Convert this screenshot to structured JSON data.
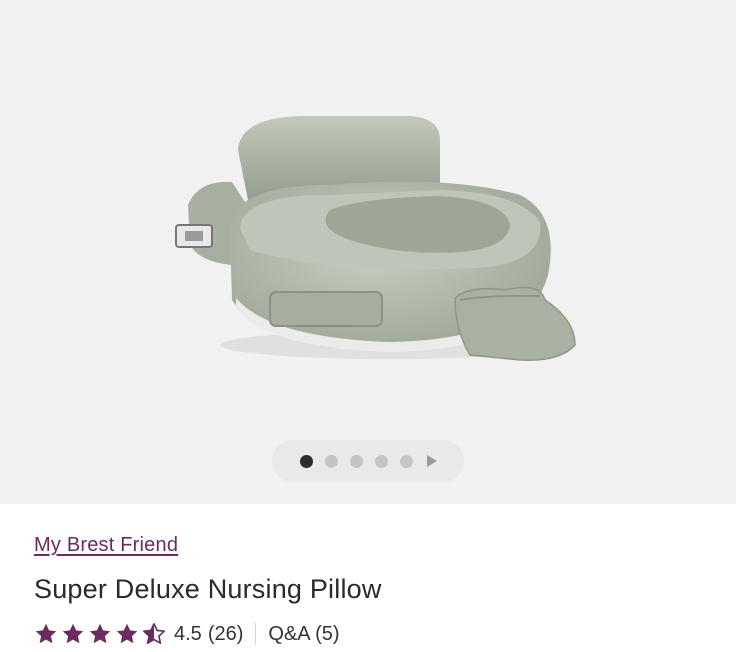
{
  "gallery": {
    "image_alt": "Super Deluxe Nursing Pillow product image",
    "dots_total": 5,
    "active_index": 0
  },
  "product": {
    "brand": "My Brest Friend",
    "title": "Super Deluxe Nursing Pillow",
    "rating": "4.5",
    "rating_value": 4.5,
    "review_count": "(26)",
    "qa_label": "Q&A (5)"
  },
  "colors": {
    "brand_purple": "#6c2a5e",
    "star_purple": "#6c2a5e",
    "pillow_green": "#b4bcae"
  }
}
